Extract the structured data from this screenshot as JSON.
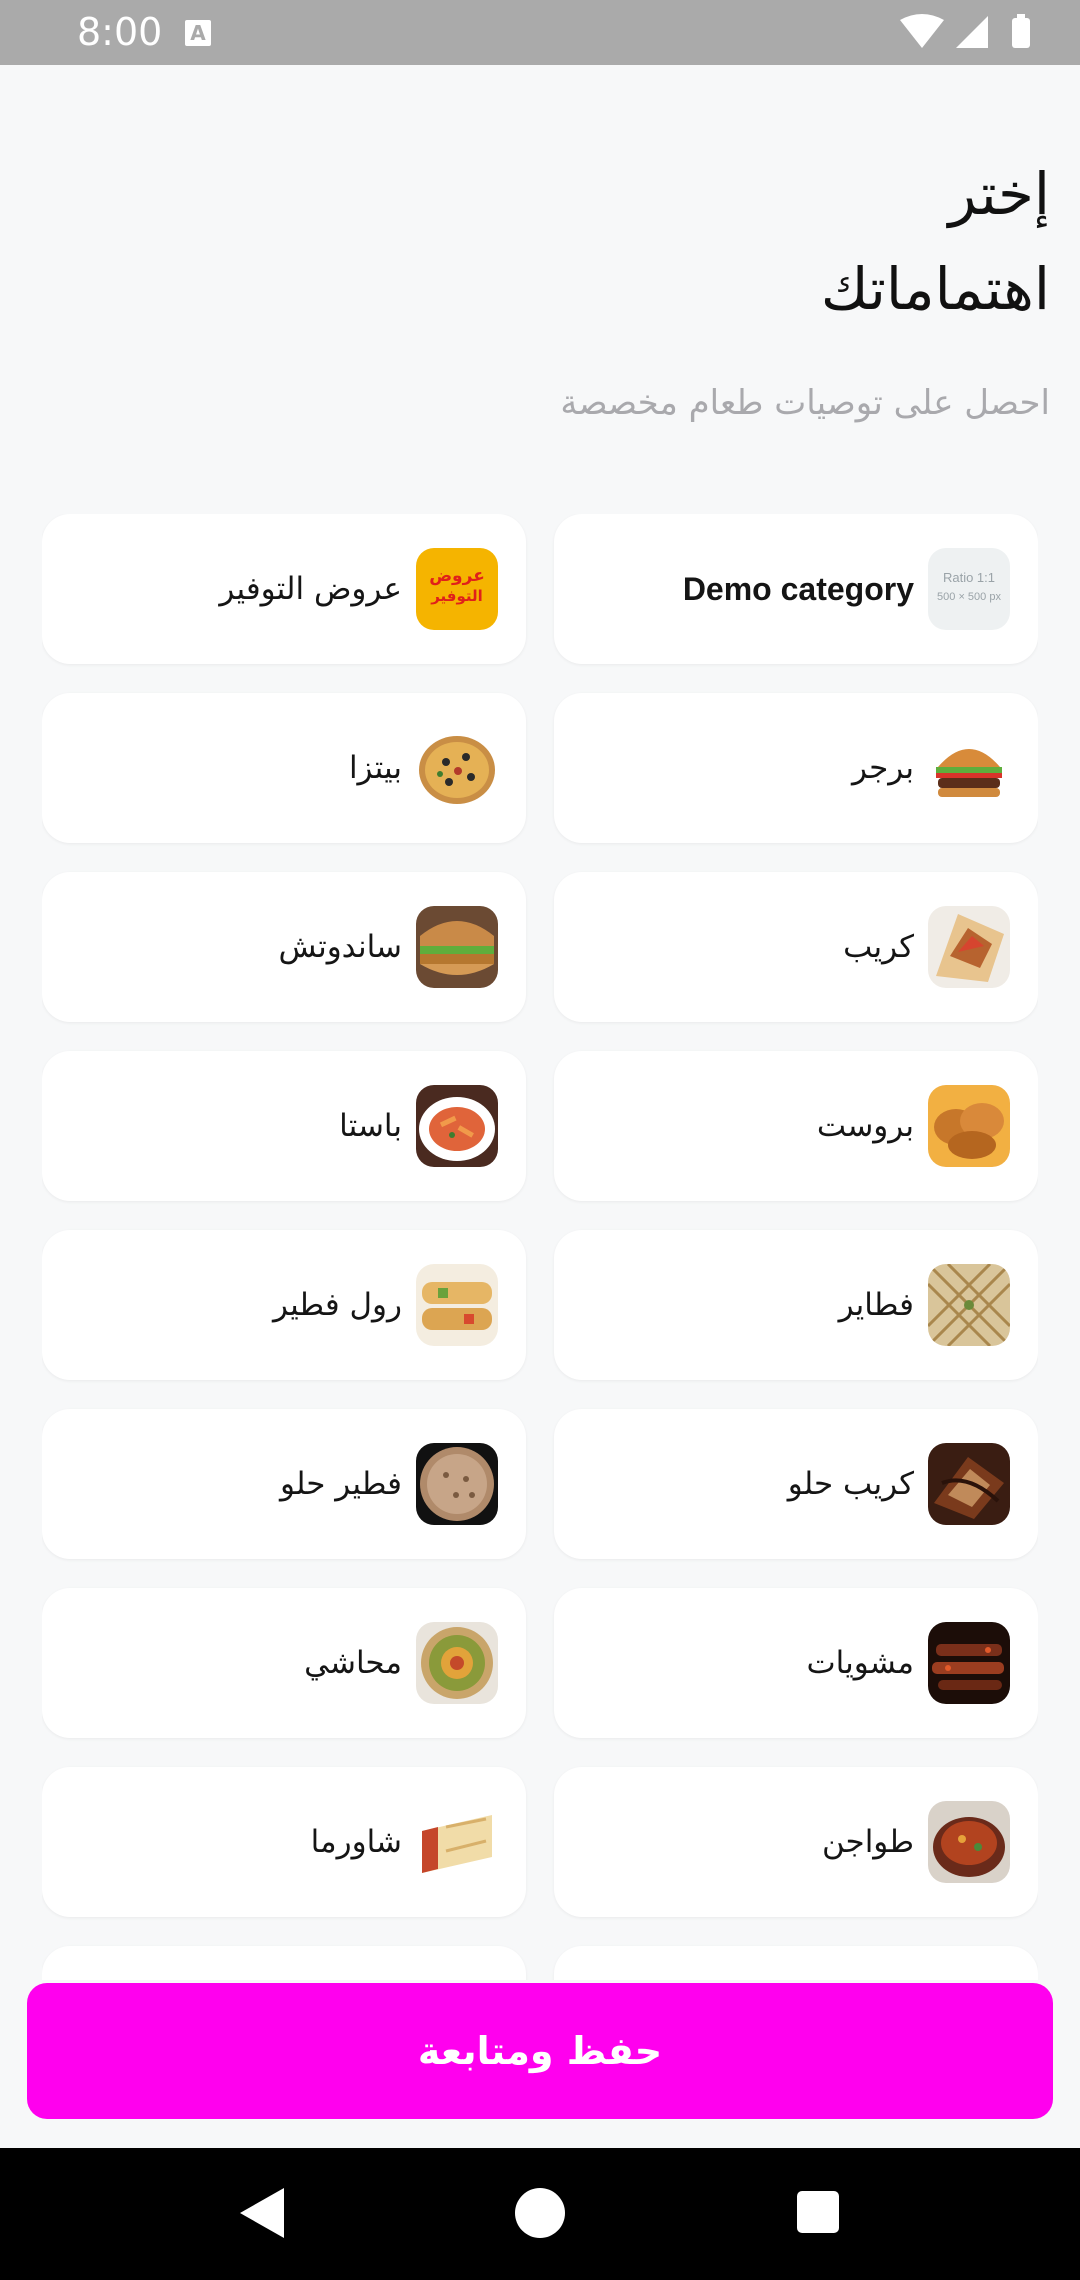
{
  "status_bar": {
    "time": "8:00",
    "notification_glyph": "A"
  },
  "header": {
    "title_line1": "إختر",
    "title_line2": "اهتماماتك",
    "subtitle": "احصل على توصيات طعام مخصصة"
  },
  "categories": [
    {
      "label": "Demo category",
      "icon": "placeholder-image-icon",
      "thumb_text_1": "Ratio 1:1",
      "thumb_text_2": "500 × 500 px"
    },
    {
      "label": "عروض التوفير",
      "icon": "offers-logo-icon",
      "thumb_text_1": "عروض",
      "thumb_text_2": "التوفير"
    },
    {
      "label": "برجر",
      "icon": "burger-icon"
    },
    {
      "label": "بيتزا",
      "icon": "pizza-icon"
    },
    {
      "label": "كريب",
      "icon": "crepe-icon"
    },
    {
      "label": "ساندوتش",
      "icon": "sandwich-icon"
    },
    {
      "label": "بروست",
      "icon": "broast-icon"
    },
    {
      "label": "باستا",
      "icon": "pasta-icon"
    },
    {
      "label": "فطاير",
      "icon": "pies-icon"
    },
    {
      "label": "رول فطير",
      "icon": "pie-roll-icon"
    },
    {
      "label": "كريب حلو",
      "icon": "sweet-crepe-icon"
    },
    {
      "label": "فطير حلو",
      "icon": "sweet-pie-icon"
    },
    {
      "label": "مشويات",
      "icon": "grills-icon"
    },
    {
      "label": "محاشي",
      "icon": "stuffed-vegetables-icon"
    },
    {
      "label": "طواجن",
      "icon": "tagine-icon"
    },
    {
      "label": "شاورما",
      "icon": "shawarma-icon"
    },
    {
      "label": "",
      "icon": ""
    },
    {
      "label": "",
      "icon": ""
    }
  ],
  "save_button": {
    "label": "حفظ ومتابعة"
  },
  "colors": {
    "accent": "#ff00ee",
    "background": "#f7f8f9",
    "card": "#ffffff",
    "status_bar": "#aaaaaa"
  }
}
